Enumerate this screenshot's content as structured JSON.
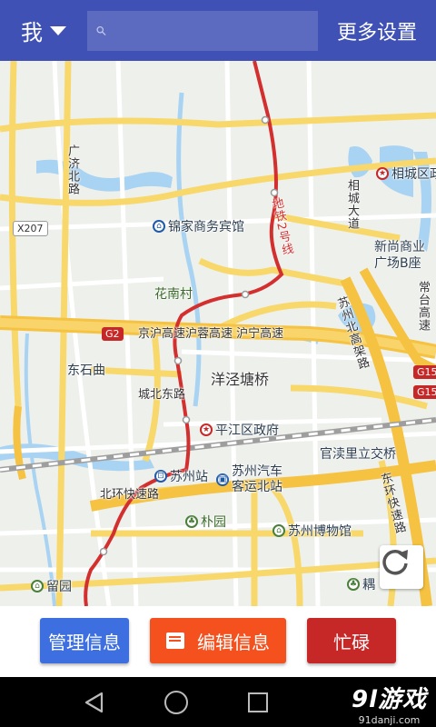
{
  "header": {
    "user_menu_label": "我",
    "search_placeholder": "",
    "more_settings_label": "更多设置"
  },
  "map": {
    "labels": {
      "guangji_north_road": "广济北路",
      "x207": "X207",
      "jinjia_hotel": "锦家商务宾馆",
      "xiangcheng_district": "相城区政",
      "xiangcheng_avenue": "相城大道",
      "xingang_plaza": "新尚商业广场B座",
      "metro_line_2": "地铁2号线",
      "huanan_village": "花南村",
      "g2": "G2",
      "jinghu_expressway": "京沪高速沪蓉高速 沪宁高速",
      "changtai_expressway": "常台高速",
      "suzhou_north_elevated": "苏州北高架路",
      "g15": "G15",
      "dongshiqu": "东石曲",
      "yangjing_tangqiao": "洋泾塘桥",
      "chengbei_east_road": "城北东路",
      "pingjiang_gov": "平江区政府",
      "guanduli_interchange": "官渎里立交桥",
      "suzhou_station": "苏州站",
      "suzhou_bus_north": "苏州汽车客运北站",
      "beihuan_expressway": "北环快速路",
      "dongxing_express": "东环快速路",
      "puyuan": "朴园",
      "suzhou_museum": "苏州博物馆",
      "liuyuan": "留园",
      "ouyuan": "耦"
    }
  },
  "actions": {
    "manage_label": "管理信息",
    "edit_label": "编辑信息",
    "busy_label": "忙碌"
  },
  "watermark": {
    "main": "9l游戏",
    "sub": "91danji.com"
  },
  "colors": {
    "header_bg": "#3f51b5",
    "manage_btn": "#3d6fe0",
    "edit_btn": "#f4511e",
    "busy_btn": "#c62828",
    "metro_line": "#d32f2f",
    "expressway": "#f5c242"
  },
  "icons": {
    "search": "search-icon",
    "dropdown": "caret-down-icon",
    "refresh": "refresh-icon",
    "edit": "message-edit-icon",
    "back": "nav-back-icon",
    "home": "nav-home-icon",
    "recent": "nav-recent-icon"
  }
}
